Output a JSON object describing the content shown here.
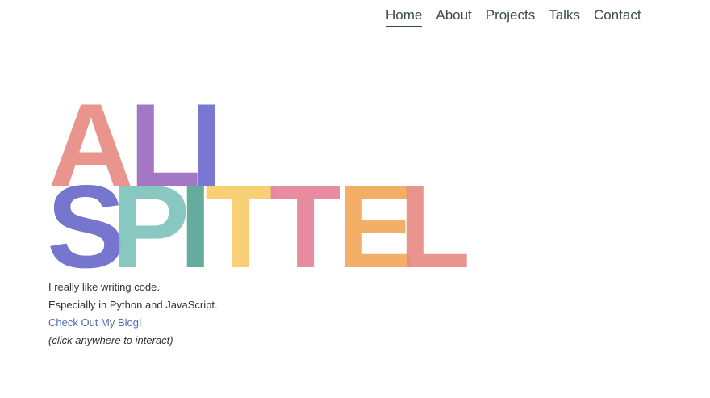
{
  "nav": {
    "items": [
      {
        "label": "Home",
        "active": true
      },
      {
        "label": "About",
        "active": false
      },
      {
        "label": "Projects",
        "active": false
      },
      {
        "label": "Talks",
        "active": false
      },
      {
        "label": "Contact",
        "active": false
      }
    ]
  },
  "hero": {
    "first_name": {
      "letters": [
        {
          "char": "A",
          "color": "#e88d85"
        },
        {
          "char": "L",
          "color": "#9c6cc2"
        },
        {
          "char": "I",
          "color": "#6f6cd0"
        }
      ]
    },
    "last_name": {
      "letters": [
        {
          "char": "S",
          "color": "#6b6bcc"
        },
        {
          "char": "P",
          "color": "#7fc4bb"
        },
        {
          "char": "I",
          "color": "#5aa596"
        },
        {
          "char": "T",
          "color": "#f7cb6a"
        },
        {
          "char": "T",
          "color": "#e7839a"
        },
        {
          "char": "E",
          "color": "#f2a85c"
        },
        {
          "char": "L",
          "color": "#e88d85"
        }
      ]
    }
  },
  "intro": {
    "line1": "I really like writing code.",
    "line2": "Especially in Python and JavaScript.",
    "blog_link": "Check Out My Blog!",
    "hint": "(click anywhere to interact)"
  }
}
